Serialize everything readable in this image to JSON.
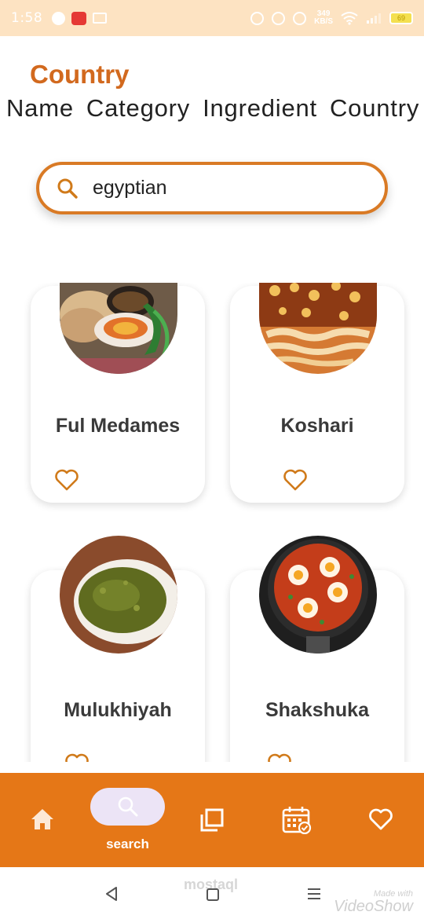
{
  "status_bar": {
    "time": "1:58",
    "speed_value": "349",
    "speed_unit": "KB/S",
    "battery": "69"
  },
  "header": {
    "title": "Country"
  },
  "tabs": [
    {
      "label": "Name"
    },
    {
      "label": "Category"
    },
    {
      "label": "Ingredient"
    },
    {
      "label": "Country"
    }
  ],
  "search": {
    "value": "egyptian",
    "icon": "search-icon"
  },
  "meals": [
    {
      "name": "Ful Medames"
    },
    {
      "name": "Koshari"
    },
    {
      "name": "Mulukhiyah"
    },
    {
      "name": "Shakshuka"
    }
  ],
  "bottom_nav": {
    "items": [
      {
        "icon": "home-icon"
      },
      {
        "icon": "search-icon",
        "label": "search",
        "active": true
      },
      {
        "icon": "category-icon"
      },
      {
        "icon": "calendar-icon"
      },
      {
        "icon": "heart-icon"
      }
    ],
    "active_pill_color": "#ece4f6",
    "bar_color": "#e57717"
  },
  "system_nav": {
    "watermark_line1": "Made with",
    "watermark_line2": "VideoShow",
    "center_mark": "mostaql"
  },
  "colors": {
    "accent": "#d2691e",
    "heart": "#d07a1a"
  }
}
